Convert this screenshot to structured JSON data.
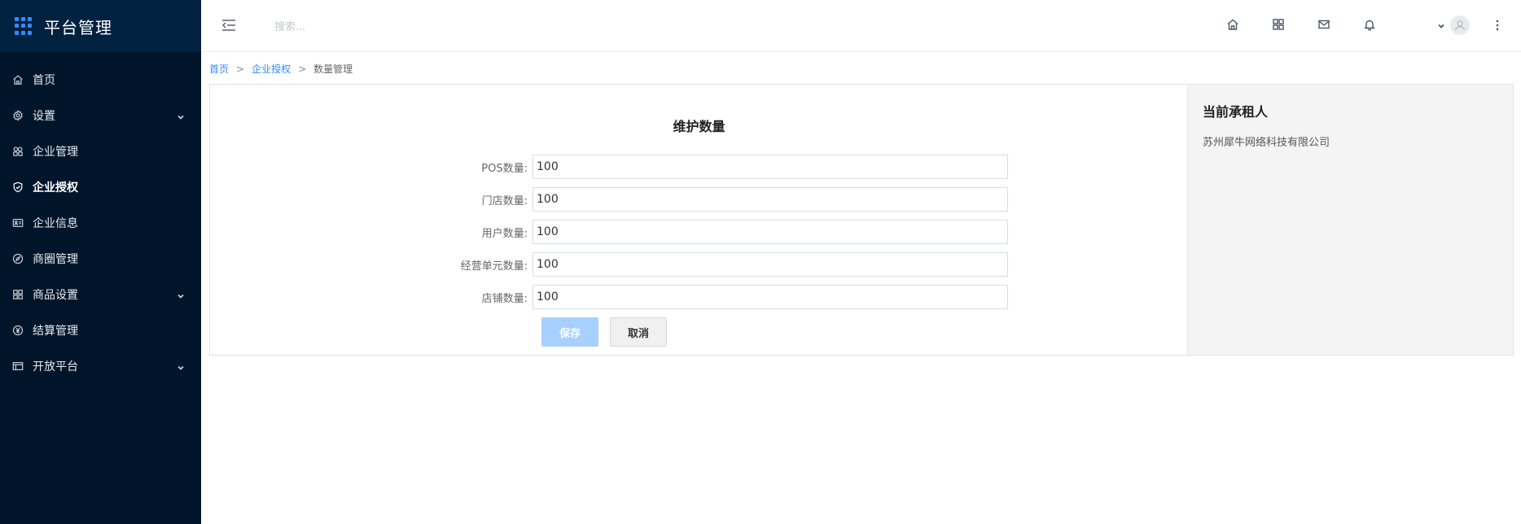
{
  "brand": {
    "title": "平台管理"
  },
  "sidebar": {
    "items": [
      {
        "label": "首页",
        "icon": "home-icon",
        "has_children": false,
        "active": false
      },
      {
        "label": "设置",
        "icon": "gear-icon",
        "has_children": true,
        "active": false
      },
      {
        "label": "企业管理",
        "icon": "cluster-icon",
        "has_children": false,
        "active": false
      },
      {
        "label": "企业授权",
        "icon": "shield-check-icon",
        "has_children": false,
        "active": true
      },
      {
        "label": "企业信息",
        "icon": "id-card-icon",
        "has_children": false,
        "active": false
      },
      {
        "label": "商圈管理",
        "icon": "compass-icon",
        "has_children": false,
        "active": false
      },
      {
        "label": "商品设置",
        "icon": "grid-icon",
        "has_children": true,
        "active": false
      },
      {
        "label": "结算管理",
        "icon": "yen-circle-icon",
        "has_children": false,
        "active": false
      },
      {
        "label": "开放平台",
        "icon": "table-icon",
        "has_children": true,
        "active": false
      }
    ]
  },
  "header": {
    "search_placeholder": "搜索...",
    "icons": [
      "home-icon",
      "apps-grid-icon",
      "mail-icon",
      "bell-icon"
    ]
  },
  "breadcrumb": {
    "items": [
      "首页",
      "企业授权",
      "数量管理"
    ],
    "separator": ">"
  },
  "form": {
    "title": "维护数量",
    "fields": [
      {
        "label": "POS数量:",
        "value": "100"
      },
      {
        "label": "门店数量:",
        "value": "100"
      },
      {
        "label": "用户数量:",
        "value": "100"
      },
      {
        "label": "经营单元数量:",
        "value": "100"
      },
      {
        "label": "店铺数量:",
        "value": "100"
      }
    ],
    "save_label": "保存",
    "cancel_label": "取消"
  },
  "tenant": {
    "title": "当前承租人",
    "name": "苏州犀牛网络科技有限公司"
  },
  "colors": {
    "sidebar_bg": "#001529",
    "accent": "#2f8cff",
    "save_disabled": "#a8d0ff"
  }
}
